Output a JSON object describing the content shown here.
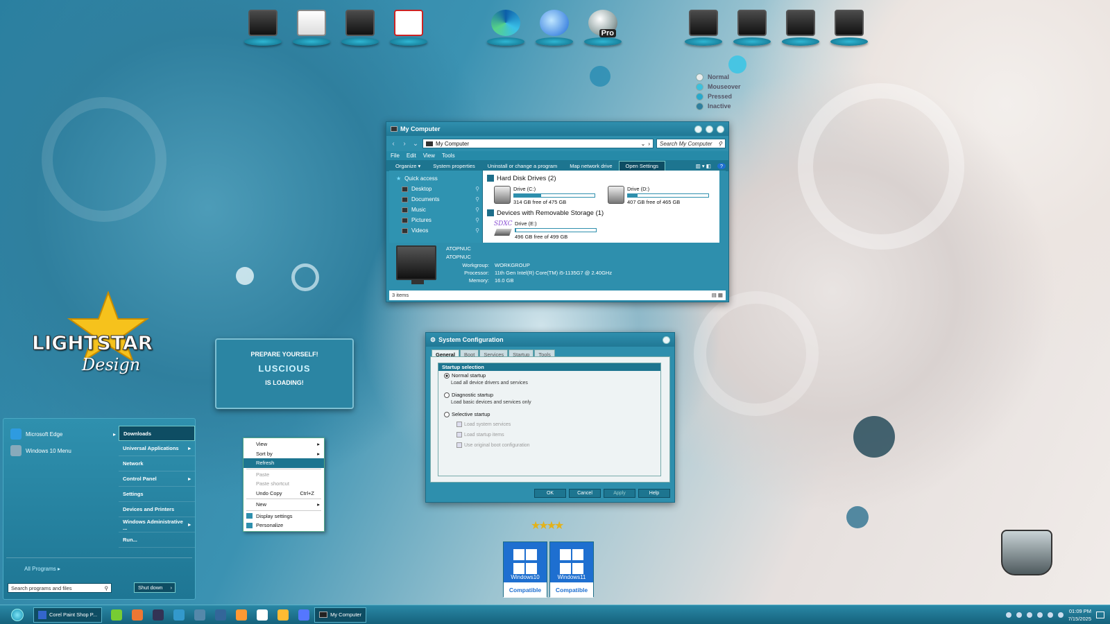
{
  "colors": {
    "accent": "#2e8fad",
    "accent_dark": "#1d7590",
    "selection": "#0e4d63"
  },
  "dock_icons": [
    {
      "name": "monitor-icon",
      "kind": "mon"
    },
    {
      "name": "documents-icon",
      "kind": "doc"
    },
    {
      "name": "network-dish-icon",
      "kind": "mon"
    },
    {
      "name": "calendar-check-icon",
      "kind": "cal"
    },
    {
      "name": "edge-icon",
      "kind": "edge"
    },
    {
      "name": "thunderbird-icon",
      "kind": "bird"
    },
    {
      "name": "globe-pro-icon",
      "kind": "globe",
      "badge": "Pro"
    },
    {
      "name": "camera-drive-icon",
      "kind": "mon"
    },
    {
      "name": "drive-icon",
      "kind": "mon"
    },
    {
      "name": "drive-icon",
      "kind": "mon"
    },
    {
      "name": "drive-icon",
      "kind": "mon"
    }
  ],
  "legend": [
    {
      "label": "Normal",
      "color": "#e9ecec"
    },
    {
      "label": "Mouseover",
      "color": "#3cc0dd"
    },
    {
      "label": "Pressed",
      "color": "#27a8cc"
    },
    {
      "label": "Inactive",
      "color": "#2f7f9e"
    }
  ],
  "mycomputer": {
    "title": "My Computer",
    "address": "My Computer",
    "search_placeholder": "Search My Computer",
    "menu": [
      "File",
      "Edit",
      "View",
      "Tools"
    ],
    "commands": [
      "Organize ▾",
      "System properties",
      "Uninstall or change a program",
      "Map network drive",
      "Open Settings"
    ],
    "nav": [
      "Quick access",
      "Desktop",
      "Documents",
      "Music",
      "Pictures",
      "Videos"
    ],
    "group_hdd": "Hard Disk Drives (2)",
    "group_removable": "Devices with Removable Storage (1)",
    "drives": [
      {
        "name": "Drive (C:)",
        "free": "314 GB free of 475 GB",
        "used_fraction": 0.34
      },
      {
        "name": "Drive (D:)",
        "free": "407 GB free of 465 GB",
        "used_fraction": 0.12
      }
    ],
    "removable": {
      "name": "Drive (E:)",
      "free": "496 GB free of 499 GB",
      "used_fraction": 0.01,
      "brand": "SDXC"
    },
    "details": {
      "name1": "ATOPNUC",
      "name2": "ATOPNUC",
      "workgroup_label": "Workgroup:",
      "workgroup": "WORKGROUP",
      "processor_label": "Processor:",
      "processor": "11th Gen Intel(R) Core(TM) i5-1135G7 @ 2.40GHz",
      "memory_label": "Memory:",
      "memory": "16.0 GB"
    },
    "status": "3 items"
  },
  "sysconfig": {
    "title": "System Configuration",
    "tabs": [
      "General",
      "Boot",
      "Services",
      "Startup",
      "Tools"
    ],
    "legend": "Startup selection",
    "normal": "Normal startup",
    "normal_desc": "Load all device drivers and services",
    "diagnostic": "Diagnostic startup",
    "diagnostic_desc": "Load basic devices and services only",
    "selective": "Selective startup",
    "checks": [
      "Load system services",
      "Load startup items",
      "Use original boot configuration"
    ],
    "buttons": [
      "OK",
      "Cancel",
      "Apply",
      "Help"
    ]
  },
  "loading": {
    "line1": "PREPARE YOURSELF!",
    "line2": "LUSCIOUS",
    "line3": "IS LOADING!"
  },
  "logo": {
    "text1": "LIGHTSTAR",
    "text2": "Design"
  },
  "startmenu": {
    "pinned": [
      {
        "label": "Microsoft Edge",
        "arrow": "▸"
      },
      {
        "label": "Windows 10 Menu"
      }
    ],
    "right": [
      {
        "label": "Downloads",
        "arrow": ""
      },
      {
        "label": "Universal Applications",
        "arrow": "▸"
      },
      {
        "label": "Network",
        "arrow": ""
      },
      {
        "label": "Control Panel",
        "arrow": "▸"
      },
      {
        "label": "Settings",
        "arrow": ""
      },
      {
        "label": "Devices and Printers",
        "arrow": ""
      },
      {
        "label": "Windows Administrative ...",
        "arrow": "▸"
      },
      {
        "label": "Run...",
        "arrow": ""
      }
    ],
    "all_programs": "All Programs",
    "search_placeholder": "Search programs and files",
    "shutdown": "Shut down"
  },
  "context": {
    "items": [
      {
        "label": "View",
        "arrow": "▸"
      },
      {
        "label": "Sort by",
        "arrow": "▸"
      },
      {
        "label": "Refresh",
        "state": "selected"
      },
      {
        "sep": true
      },
      {
        "label": "Paste",
        "state": "disabled"
      },
      {
        "label": "Paste shortcut",
        "state": "disabled"
      },
      {
        "label": "Undo Copy",
        "shortcut": "Ctrl+Z"
      },
      {
        "sep": true
      },
      {
        "label": "New",
        "arrow": "▸"
      },
      {
        "sep": true
      },
      {
        "label": "Display settings",
        "icon": true
      },
      {
        "label": "Personalize",
        "icon": true
      }
    ]
  },
  "badges": [
    {
      "name": "Windows10",
      "caption": "Compatible"
    },
    {
      "name": "Windows11",
      "caption": "Compatible"
    }
  ],
  "taskbar": {
    "apps": [
      {
        "label": "Corel Paint Shop P...",
        "active": false
      }
    ],
    "pinned_icons": [
      "recycle-icon",
      "folder-icon",
      "obs-icon",
      "network-icon",
      "globe-icon",
      "stack-icon",
      "media-icon",
      "shield-icon",
      "weather-icon",
      "chat-icon"
    ],
    "window_button": "My Computer",
    "time": "01:09 PM",
    "date": "7/15/2025"
  }
}
